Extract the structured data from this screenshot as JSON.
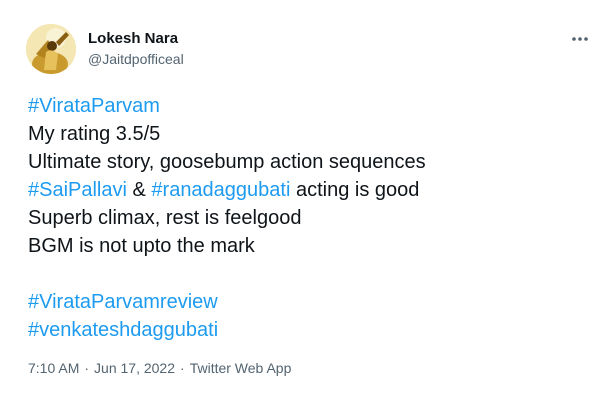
{
  "author": {
    "display_name": "Lokesh Nara",
    "handle": "@Jaitdpofficeal",
    "avatar_icon": "profile-photo"
  },
  "more_icon": "more-horizontal-icon",
  "tweet": {
    "line1": {
      "hashtag": "#VirataParvam"
    },
    "line2": {
      "text": "My rating 3.5/5"
    },
    "line3": {
      "text": "Ultimate story, goosebump action sequences"
    },
    "line4": {
      "hashtag1": "#SaiPallavi",
      "joiner": " & ",
      "hashtag2": "#ranadaggubati",
      "tail": " acting is good"
    },
    "line5": {
      "text": "Superb climax, rest is feelgood"
    },
    "line6": {
      "text": "BGM is not upto the mark"
    },
    "line7": {
      "hashtag": "#VirataParvamreview"
    },
    "line8": {
      "hashtag": "#venkateshdaggubati"
    }
  },
  "meta": {
    "time": "7:10 AM",
    "separator": "·",
    "date": "Jun 17, 2022",
    "source": "Twitter Web App"
  },
  "colors": {
    "link": "#1d9bf0",
    "text": "#0f1419",
    "secondary": "#536471"
  }
}
